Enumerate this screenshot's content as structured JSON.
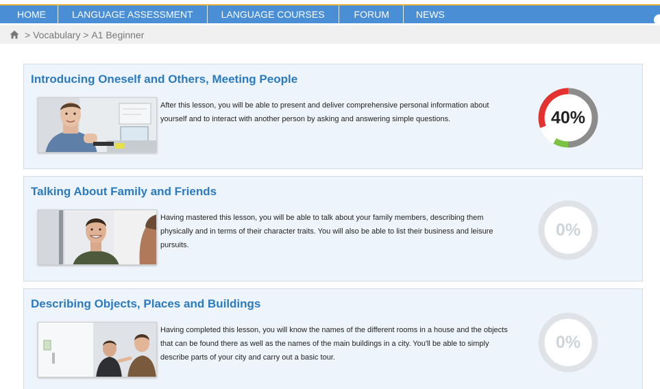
{
  "nav": {
    "items": [
      {
        "label": "HOME"
      },
      {
        "label": "LANGUAGE ASSESSMENT"
      },
      {
        "label": "LANGUAGE COURSES"
      },
      {
        "label": "FORUM"
      },
      {
        "label": "NEWS"
      }
    ]
  },
  "breadcrumb": {
    "home_icon": "home-icon",
    "items": [
      {
        "label": "Vocabulary"
      },
      {
        "label": "A1 Beginner"
      }
    ],
    "separator": ">"
  },
  "lessons": [
    {
      "title": "Introducing Oneself and Others, Meeting People",
      "description": "After this lesson, you will be able to present and deliver comprehensive personal information about yourself and to interact with another person by asking and answering simple questions.",
      "progress": 40,
      "progress_label": "40%"
    },
    {
      "title": "Talking About Family and Friends",
      "description": "Having mastered this lesson, you will be able to talk about your family members, describing them physically and in terms of their character traits. You will also be able to list their business and leisure pursuits.",
      "progress": 0,
      "progress_label": "0%"
    },
    {
      "title": "Describing Objects, Places and Buildings",
      "description": "Having completed this lesson, you will know the names of the different rooms in a house and the objects that can be found there as well as the names of the main buildings in a city. You'll be able to simply describe parts of your city and carry out a basic tour.",
      "progress": 0,
      "progress_label": "0%"
    }
  ],
  "colors": {
    "nav_bg": "#4a8fd6",
    "accent_line": "#e8b43a",
    "title": "#2a7abf",
    "card_bg": "#eef4fb",
    "progress_red": "#e53030",
    "progress_green": "#7bc142",
    "progress_gray": "#8c8c8c",
    "progress_empty": "#dfe3e7"
  }
}
